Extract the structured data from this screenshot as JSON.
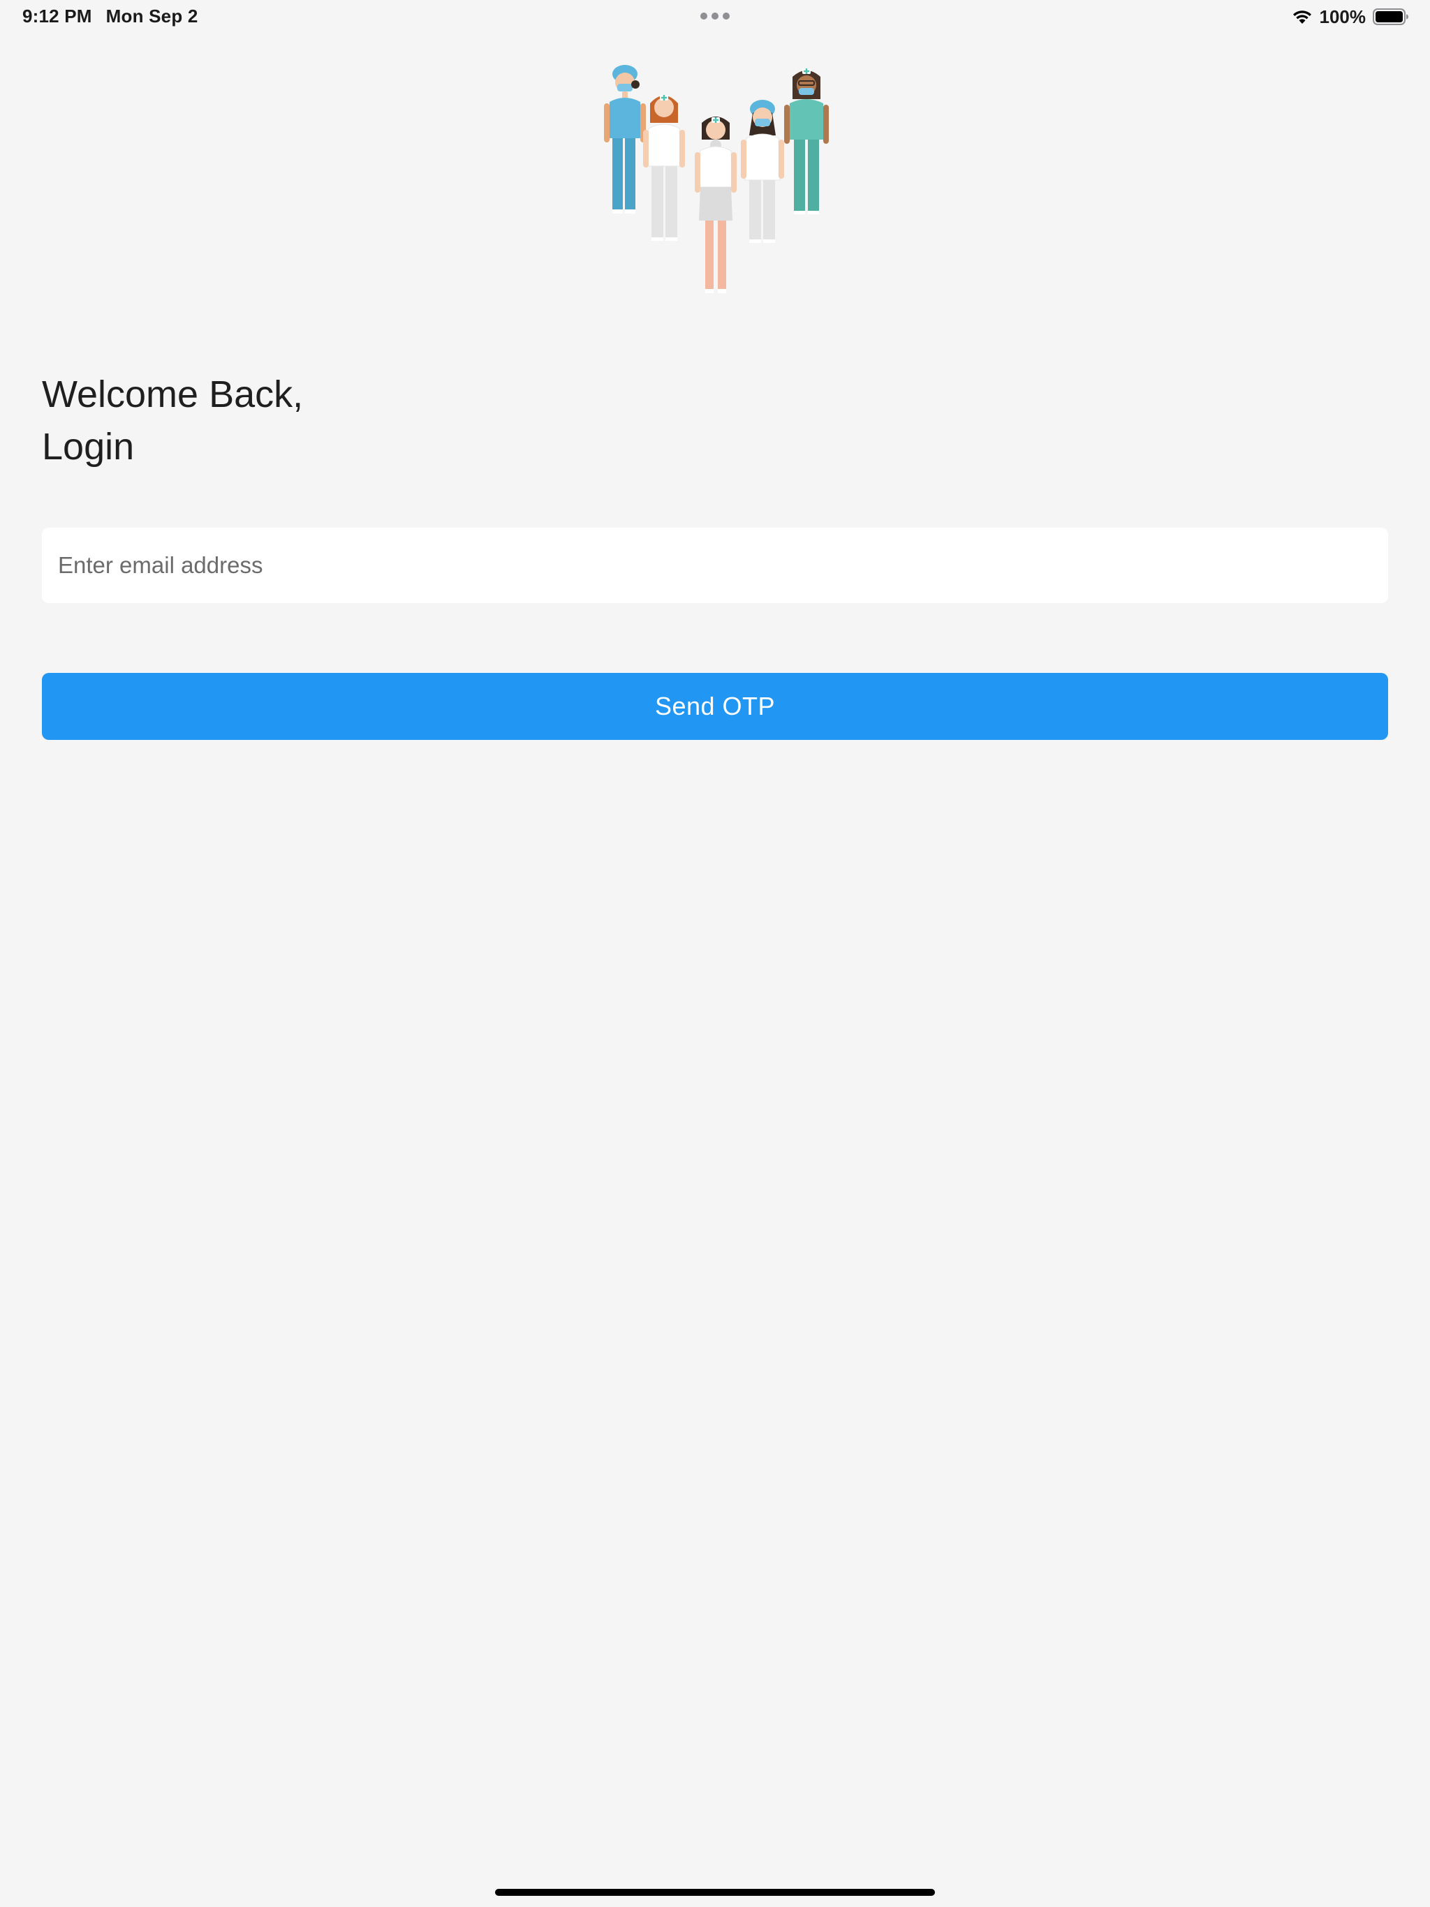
{
  "status_bar": {
    "time": "9:12 PM",
    "date": "Mon Sep 2",
    "battery_percent": "100%",
    "icons": [
      "wifi-icon",
      "battery-icon"
    ]
  },
  "illustration": {
    "icon": "medical-staff-illustration"
  },
  "login": {
    "heading_line1": "Welcome Back,",
    "heading_line2": "Login",
    "email_placeholder": "Enter email address",
    "email_value": "",
    "send_button_label": "Send OTP"
  },
  "colors": {
    "background": "#f5f5f5",
    "accent": "#2196f3",
    "input_background": "#ffffff"
  }
}
